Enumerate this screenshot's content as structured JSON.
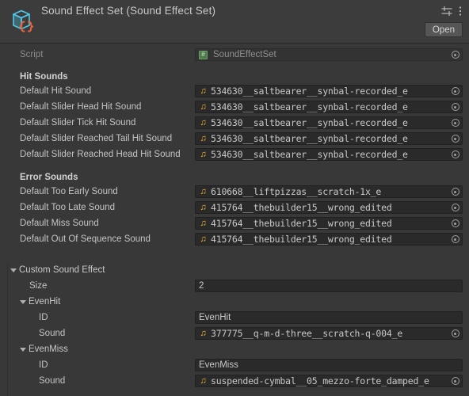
{
  "header": {
    "title": "Sound Effect Set (Sound Effect Set)",
    "object_icon": "scriptable-object-icon",
    "settings_icon": "preset-settings-icon",
    "kebab_icon": "more-options-icon",
    "open_label": "Open"
  },
  "script_row": {
    "label": "Script",
    "value": "SoundEffectSet",
    "icon": "csharp-script-icon"
  },
  "sections": [
    {
      "name": "hit-sounds",
      "title": "Hit Sounds",
      "rows": [
        {
          "label": "Default Hit Sound",
          "value": "534630__saltbearer__synbal-recorded_e"
        },
        {
          "label": "Default Slider Head Hit Sound",
          "value": "534630__saltbearer__synbal-recorded_e"
        },
        {
          "label": "Default Slider Tick Hit Sound",
          "value": "534630__saltbearer__synbal-recorded_e"
        },
        {
          "label": "Default Slider Reached Tail Hit Sound",
          "value": "534630__saltbearer__synbal-recorded_e"
        },
        {
          "label": "Default Slider Reached Head Hit Sound",
          "value": "534630__saltbearer__synbal-recorded_e"
        }
      ]
    },
    {
      "name": "error-sounds",
      "title": "Error Sounds",
      "rows": [
        {
          "label": "Default Too Early Sound",
          "value": "610668__liftpizzas__scratch-1x_e"
        },
        {
          "label": "Default Too Late Sound",
          "value": "415764__thebuilder15__wrong_edited"
        },
        {
          "label": "Default Miss Sound",
          "value": "415764__thebuilder15__wrong_edited"
        },
        {
          "label": "Default Out Of Sequence Sound",
          "value": "415764__thebuilder15__wrong_edited"
        }
      ]
    }
  ],
  "custom_sound_effect": {
    "foldout_label": "Custom Sound Effect",
    "size_label": "Size",
    "size_value": "2",
    "elements": [
      {
        "foldout_label": "EvenHit",
        "id_label": "ID",
        "id_value": "EvenHit",
        "sound_label": "Sound",
        "sound_value": "377775__q-m-d-three__scratch-q-004_e"
      },
      {
        "foldout_label": "EvenMiss",
        "id_label": "ID",
        "id_value": "EvenMiss",
        "sound_label": "Sound",
        "sound_value": "suspended-cymbal__05_mezzo-forte_damped_e"
      }
    ]
  },
  "colors": {
    "background": "#383838",
    "header_background": "#3c3c3c",
    "field_background": "#2a2a2a",
    "text": "#c4c4c4",
    "accent_audio": "#f2b134",
    "icon_cube": "#4ec9e8",
    "icon_braces": "#e8603c"
  }
}
